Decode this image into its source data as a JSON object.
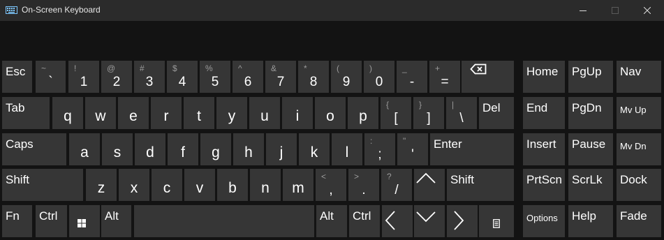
{
  "window": {
    "title": "On-Screen Keyboard",
    "icons": {
      "app": "keyboard-icon",
      "minimize": "minimize-icon",
      "maximize": "maximize-icon",
      "close": "close-icon"
    }
  },
  "colors": {
    "background": "#131313",
    "titlebar": "#2b2b2b",
    "key": "#363636",
    "key_text": "#ffffff",
    "shifted_text": "#9b9b9b"
  },
  "keys": {
    "esc": "Esc",
    "grave": {
      "main": "`",
      "shift": "~"
    },
    "d1": {
      "main": "1",
      "shift": "!"
    },
    "d2": {
      "main": "2",
      "shift": "@"
    },
    "d3": {
      "main": "3",
      "shift": "#"
    },
    "d4": {
      "main": "4",
      "shift": "$"
    },
    "d5": {
      "main": "5",
      "shift": "%"
    },
    "d6": {
      "main": "6",
      "shift": "^"
    },
    "d7": {
      "main": "7",
      "shift": "&"
    },
    "d8": {
      "main": "8",
      "shift": "*"
    },
    "d9": {
      "main": "9",
      "shift": "("
    },
    "d0": {
      "main": "0",
      "shift": ")"
    },
    "minus": {
      "main": "-",
      "shift": "_"
    },
    "equals": {
      "main": "=",
      "shift": "+"
    },
    "backspace": "backspace-icon",
    "home": "Home",
    "pgup": "PgUp",
    "nav": "Nav",
    "tab": "Tab",
    "q": "q",
    "w": "w",
    "e": "e",
    "r": "r",
    "t": "t",
    "y": "y",
    "u": "u",
    "i": "i",
    "o": "o",
    "p": "p",
    "lbracket": {
      "main": "[",
      "shift": "{"
    },
    "rbracket": {
      "main": "]",
      "shift": "}"
    },
    "backslash": {
      "main": "\\",
      "shift": "|"
    },
    "del": "Del",
    "end": "End",
    "pgdn": "PgDn",
    "mvup": "Mv Up",
    "caps": "Caps",
    "a": "a",
    "s": "s",
    "d": "d",
    "f": "f",
    "g": "g",
    "h": "h",
    "j": "j",
    "k": "k",
    "l": "l",
    "semicolon": {
      "main": ";",
      "shift": ":"
    },
    "quote": {
      "main": "'",
      "shift": "\""
    },
    "enter": "Enter",
    "insert": "Insert",
    "pause": "Pause",
    "mvdn": "Mv Dn",
    "shift_left": "Shift",
    "z": "z",
    "x": "x",
    "c": "c",
    "v": "v",
    "b": "b",
    "n": "n",
    "m": "m",
    "comma": {
      "main": ",",
      "shift": "<"
    },
    "period": {
      "main": ".",
      "shift": ">"
    },
    "slash": {
      "main": "/",
      "shift": "?"
    },
    "arrow_up": "arrow-up-icon",
    "shift_right": "Shift",
    "prtscn": "PrtScn",
    "scrlk": "ScrLk",
    "dock": "Dock",
    "fn": "Fn",
    "ctrl_left": "Ctrl",
    "win": "windows-icon",
    "alt_left": "Alt",
    "alt_right": "Alt",
    "ctrl_right": "Ctrl",
    "arrow_left": "arrow-left-icon",
    "arrow_down": "arrow-down-icon",
    "arrow_right": "arrow-right-icon",
    "menu": "context-menu-icon",
    "options": "Options",
    "help": "Help",
    "fade": "Fade"
  }
}
